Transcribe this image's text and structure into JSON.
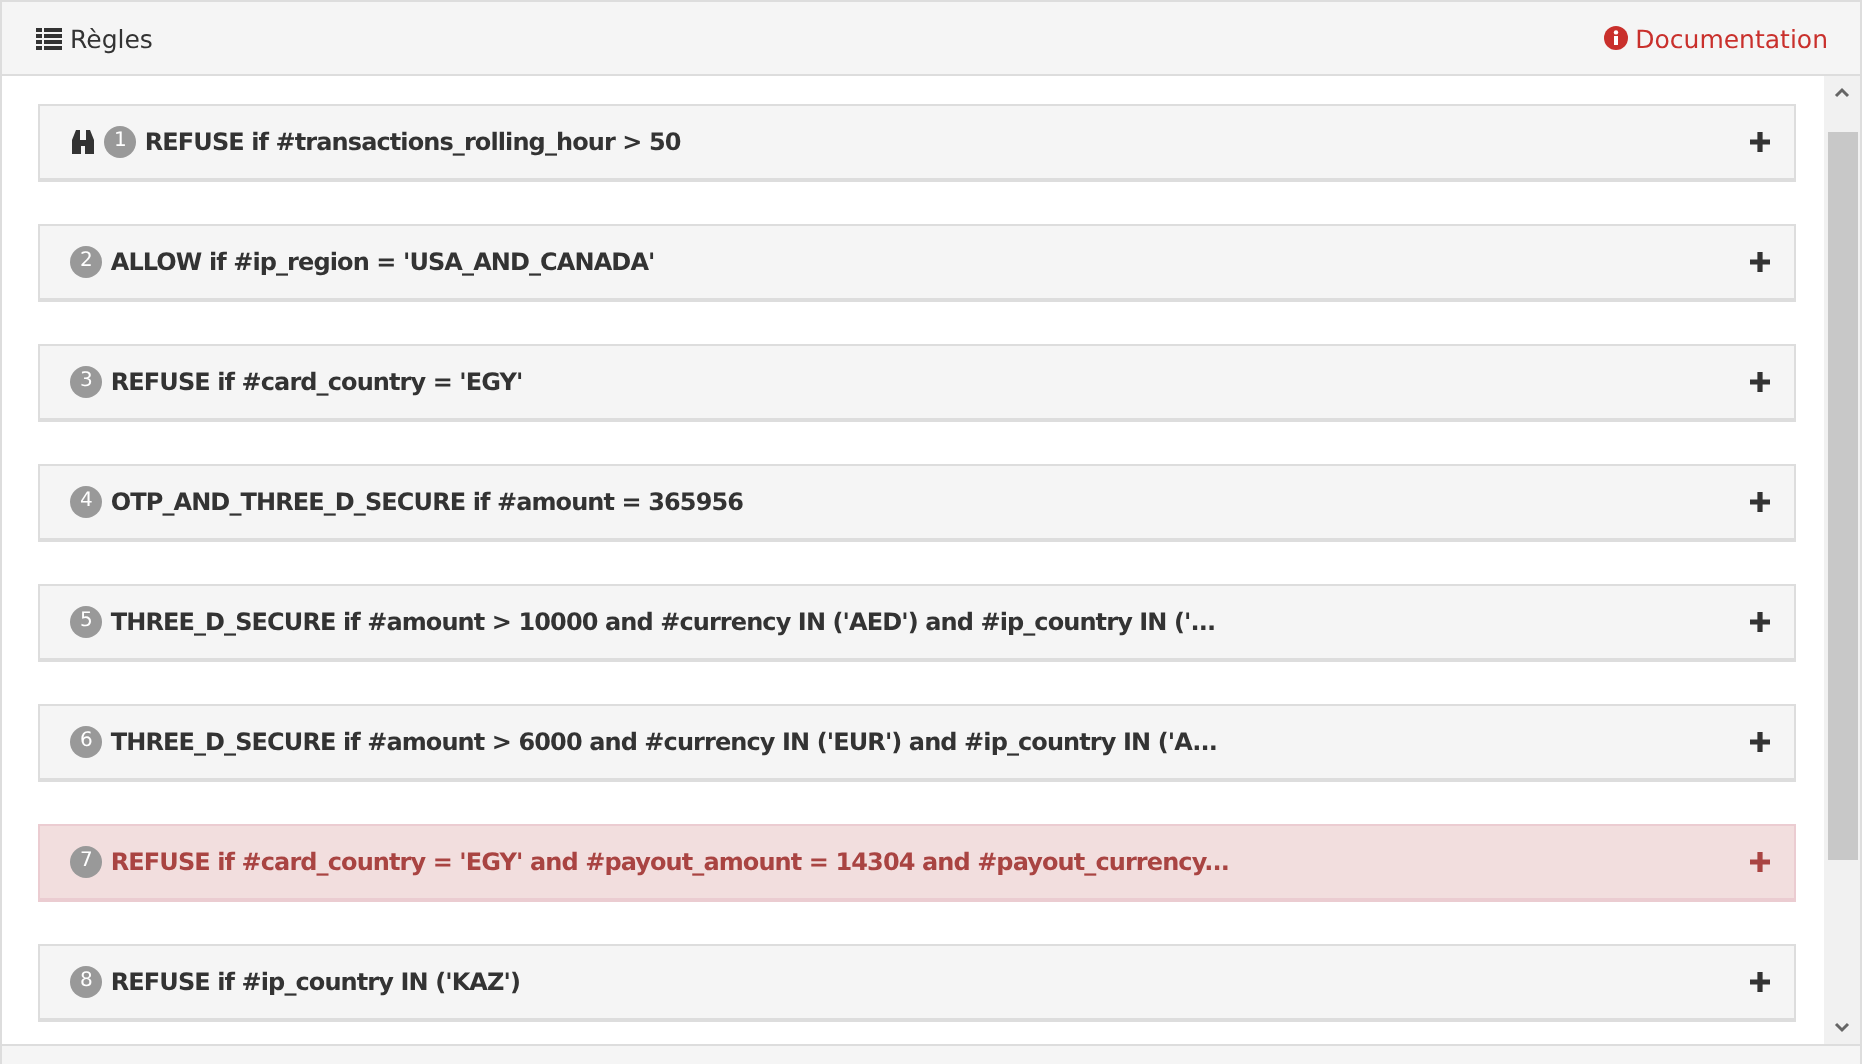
{
  "panel": {
    "title": "Règles",
    "link": "Documentation"
  },
  "rules": [
    {
      "number": "1",
      "text": "REFUSE if #transactions_rolling_hour > 50",
      "kind": "default",
      "watched": true
    },
    {
      "number": "2",
      "text": "ALLOW if #ip_region = 'USA_AND_CANADA'",
      "kind": "default",
      "watched": false
    },
    {
      "number": "3",
      "text": "REFUSE if #card_country = 'EGY'",
      "kind": "default",
      "watched": false
    },
    {
      "number": "4",
      "text": "OTP_AND_THREE_D_SECURE if #amount = 365956",
      "kind": "default",
      "watched": false
    },
    {
      "number": "5",
      "text": "THREE_D_SECURE if #amount > 10000 and #currency IN ('AED') and #ip_country IN ('...",
      "kind": "default",
      "watched": false
    },
    {
      "number": "6",
      "text": "THREE_D_SECURE if #amount > 6000 and #currency IN ('EUR') and #ip_country IN ('A...",
      "kind": "default",
      "watched": false
    },
    {
      "number": "7",
      "text": "REFUSE if #card_country = 'EGY' and #payout_amount = 14304 and #payout_currency...",
      "kind": "danger",
      "watched": false
    },
    {
      "number": "8",
      "text": "REFUSE if #ip_country IN ('KAZ')",
      "kind": "default",
      "watched": false
    }
  ]
}
